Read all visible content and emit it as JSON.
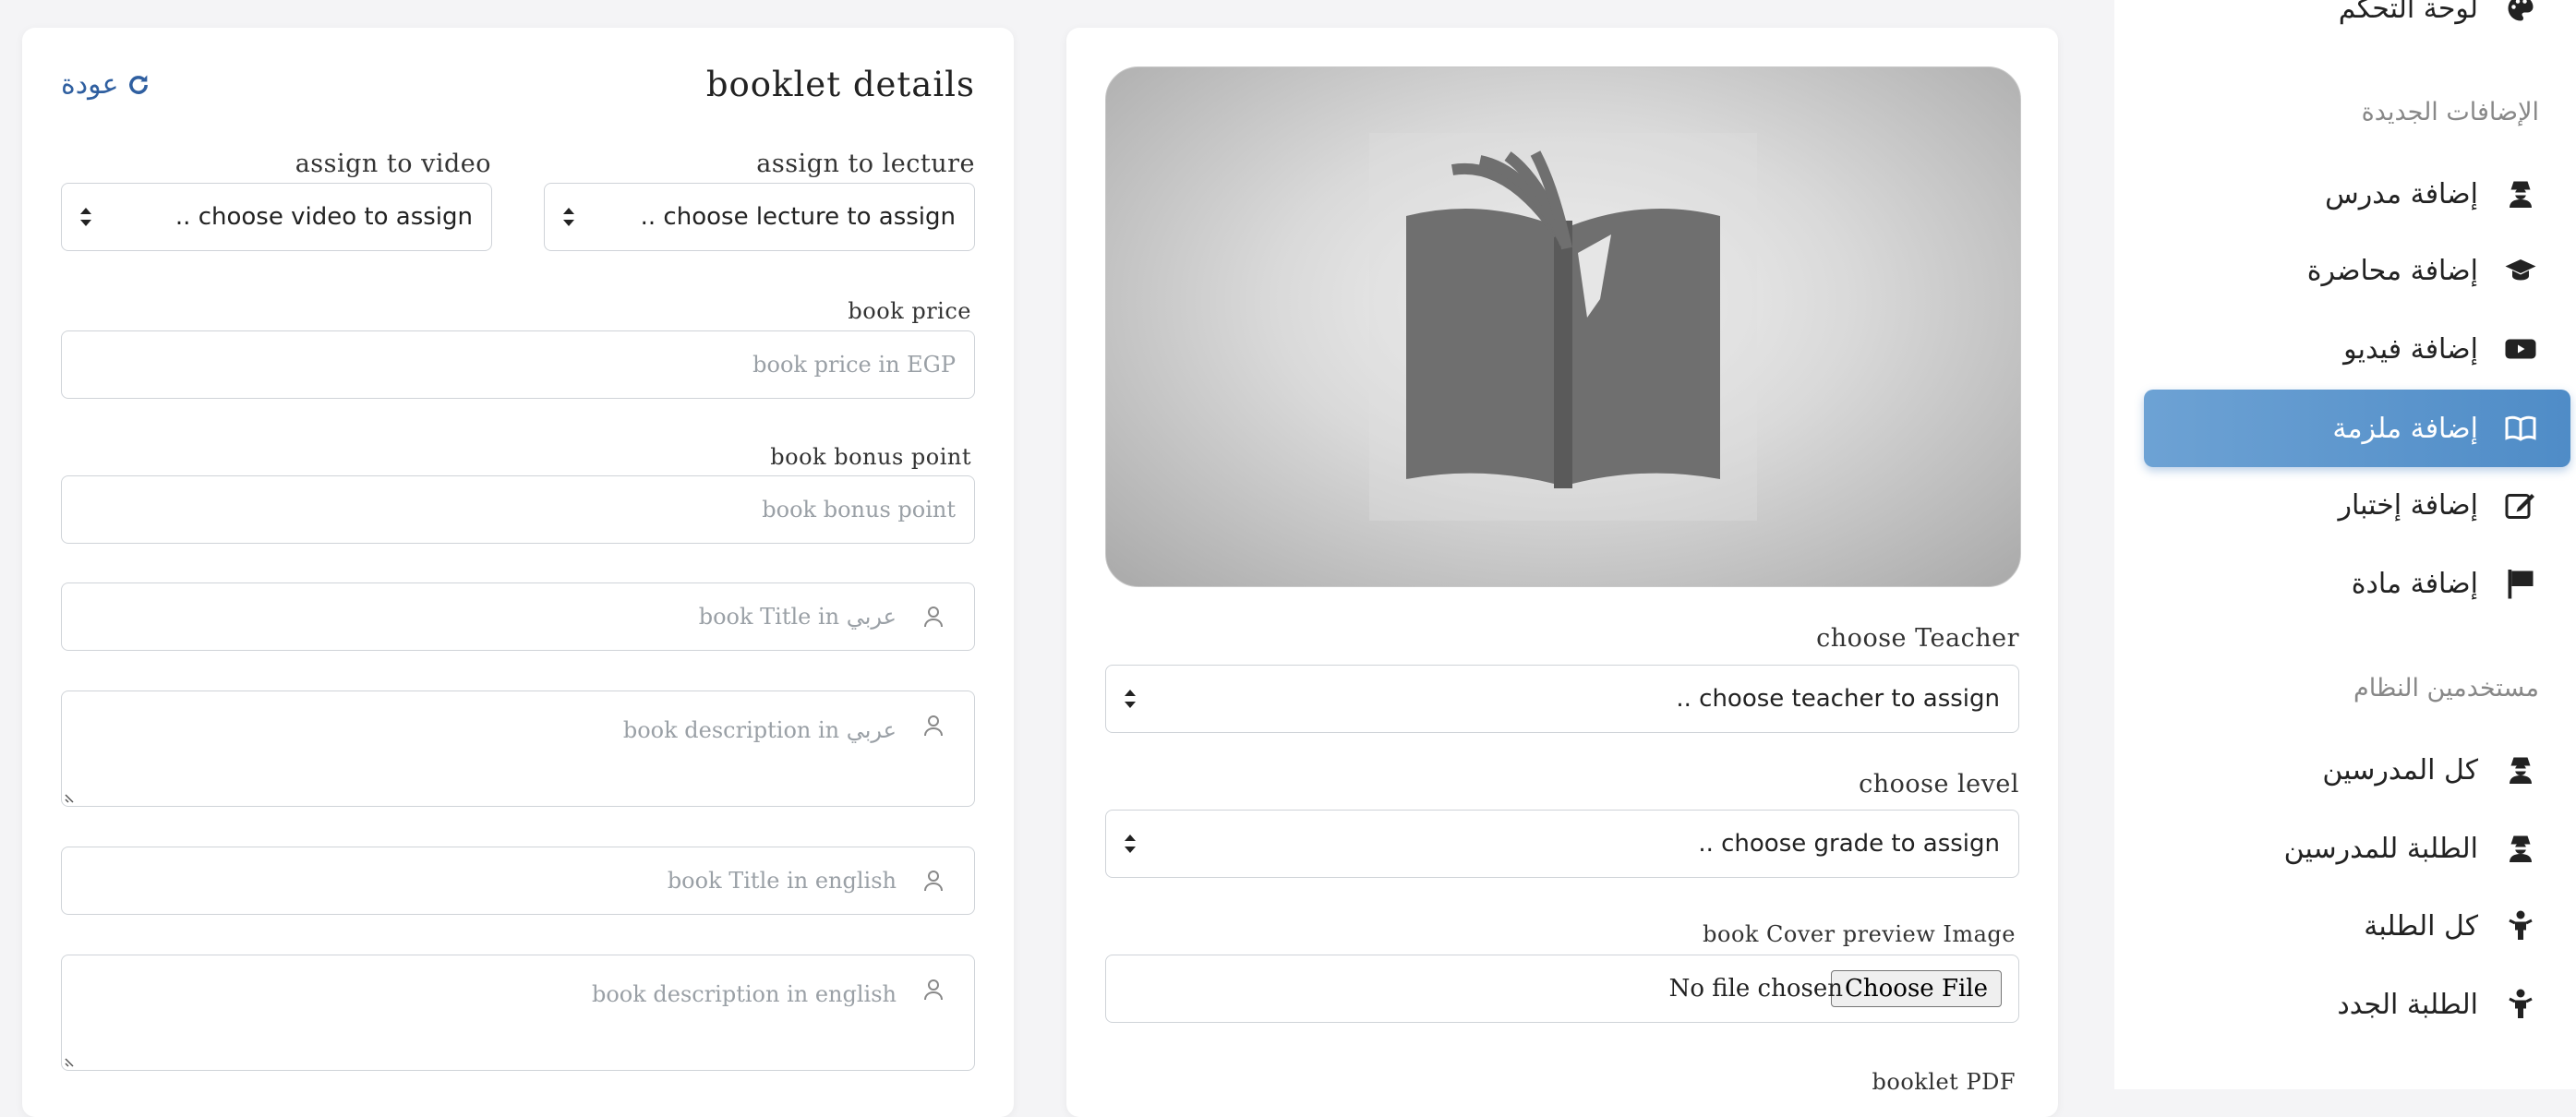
{
  "form": {
    "title": "booklet details",
    "back_label": "عودة",
    "assign_lecture_label": "assign to lecture",
    "assign_lecture_value": ".. choose lecture to assign",
    "assign_video_label": "assign to video",
    "assign_video_value": ".. choose video to assign",
    "price_label": "book price",
    "price_placeholder": "book price in EGP",
    "bonus_label": "book bonus point",
    "bonus_placeholder": "book bonus point",
    "title_ar_placeholder": "book Title in عربي",
    "desc_ar_placeholder": "book description in عربي",
    "title_en_placeholder": "book Title in english",
    "desc_en_placeholder": "book description in english"
  },
  "media": {
    "teacher_label": "choose Teacher",
    "teacher_value": ".. choose teacher to assign",
    "level_label": "choose level",
    "level_value": ".. choose grade to assign",
    "cover_label": "book Cover preview Image",
    "file_button": "Choose File",
    "file_status": "No file chosen",
    "pdf_label": "booklet PDF"
  },
  "sidebar": {
    "dashboard": "لوحة التحكم",
    "section_new": "الإضافات الجديدة",
    "add_teacher": "إضافة مدرس",
    "add_lecture": "إضافة محاضرة",
    "add_video": "إضافة فيديو",
    "add_booklet": "إضافة ملزمة",
    "add_exam": "إضافة إختبار",
    "add_subject": "إضافة مادة",
    "section_users": "مستخدمين النظام",
    "all_teachers": "كل المدرسين",
    "teachers_students": "الطلبة للمدرسين",
    "all_students": "كل الطلبة",
    "new_students": "الطلبة الجدد"
  },
  "colors": {
    "accent": "#5b96cd",
    "link": "#2f5fa0",
    "background": "#f4f4f6"
  },
  "icons": {
    "back": "refresh-icon",
    "select": "sort-arrows-icon",
    "field": "user-outline-icon",
    "teacher": "user-secret-icon",
    "lecture": "graduation-cap-icon",
    "video": "youtube-icon",
    "booklet": "open-book-icon",
    "exam": "edit-icon",
    "subject": "flag-icon",
    "student": "child-icon"
  }
}
